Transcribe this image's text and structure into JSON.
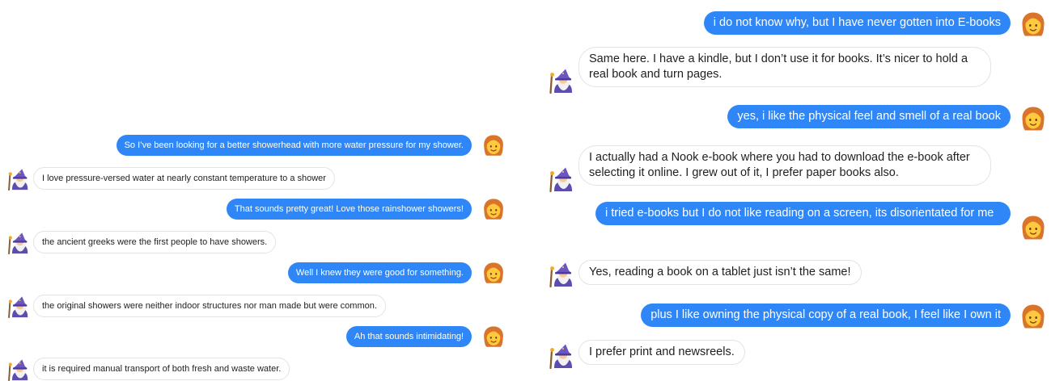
{
  "left_conversation": {
    "messages": [
      {
        "role": "user",
        "text": "So I’ve been looking for a better showerhead with more water pressure for my shower."
      },
      {
        "role": "bot",
        "text": "I love pressure-versed water at nearly constant temperature to a shower"
      },
      {
        "role": "user",
        "text": "That sounds pretty great! Love those rainshower showers!"
      },
      {
        "role": "bot",
        "text": "the ancient greeks were the first people to have showers."
      },
      {
        "role": "user",
        "text": "Well I knew they were good for something."
      },
      {
        "role": "bot",
        "text": "the original showers were neither indoor structures nor man made but were common."
      },
      {
        "role": "user",
        "text": "Ah that sounds intimidating!"
      },
      {
        "role": "bot",
        "text": "it is required manual transport of both fresh and waste water."
      }
    ]
  },
  "right_conversation": {
    "messages": [
      {
        "role": "user",
        "text": "i do not know why, but I have never gotten into E-books"
      },
      {
        "role": "bot",
        "text": "Same here. I have a kindle, but I don’t use it for books. It’s nicer to hold a real book and turn pages."
      },
      {
        "role": "user",
        "text": "yes, i like the physical feel and smell of a real book"
      },
      {
        "role": "bot",
        "text": "I actually had a Nook e-book where you had to download the e-book after selecting it online. I grew out of it, I prefer paper books also."
      },
      {
        "role": "user",
        "text": "i tried e-books but I do not like reading on a screen, its disorientated for me"
      },
      {
        "role": "bot",
        "text": "Yes, reading a book on a tablet just isn’t the same!"
      },
      {
        "role": "user",
        "text": "plus I like owning the physical copy of a real book, I feel like I own it"
      },
      {
        "role": "bot",
        "text": "I prefer print and newsreels."
      }
    ]
  },
  "avatars": {
    "user": "woman-face-icon",
    "bot": "wizard-icon"
  },
  "colors": {
    "user_bubble": "#2f86f6",
    "bot_border": "#e3e3e3",
    "background": "#ffffff"
  }
}
